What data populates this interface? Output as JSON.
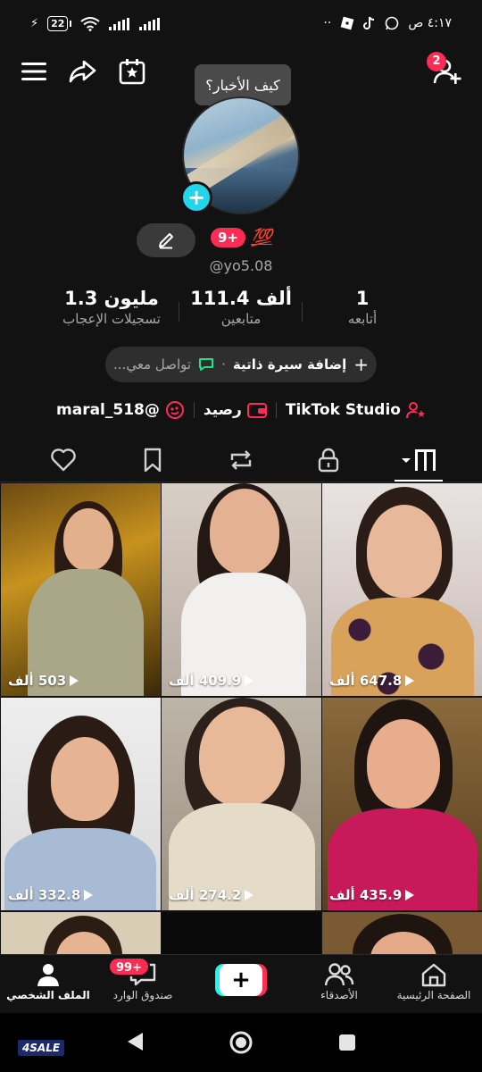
{
  "status_bar": {
    "battery": "22",
    "time": "٤:١٧ ص"
  },
  "top_bar": {
    "friend_requests_count": "2"
  },
  "tooltip": "كيف الأخبار؟",
  "profile": {
    "badge": "9+",
    "emoji": "💯",
    "username": "@yo5.08"
  },
  "stats": [
    {
      "value": "1",
      "label": "أتابعه"
    },
    {
      "value": "111.4 ألف",
      "label": "متابعين"
    },
    {
      "value": "1.3 مليون",
      "label": "تسجيلات الإعجاب"
    }
  ],
  "bio": {
    "add_bio": "إضافة سيرة ذاتية",
    "separator": "·",
    "contact": "تواصل معي..."
  },
  "links": {
    "studio": "TikTok Studio",
    "balance": "رصيد",
    "linked_account": "@maral_518"
  },
  "tabs": [
    "videos",
    "private",
    "reposts",
    "favorites",
    "liked"
  ],
  "videos": [
    {
      "views": "647.8 ألف"
    },
    {
      "views": "409.9 ألف"
    },
    {
      "views": "503 ألف"
    },
    {
      "views": "435.9 ألف"
    },
    {
      "views": "274.2 ألف"
    },
    {
      "views": "332.8 ألف"
    }
  ],
  "bottom_nav": {
    "home": "الصفحة الرئيسية",
    "friends": "الأصدقاء",
    "inbox": "صندوق الوارد",
    "inbox_badge": "99+",
    "profile": "الملف الشخصي"
  },
  "watermark": "4SALE",
  "colors": {
    "accent_red": "#fe2c55",
    "accent_cyan": "#25f4ee",
    "background": "#121212"
  }
}
